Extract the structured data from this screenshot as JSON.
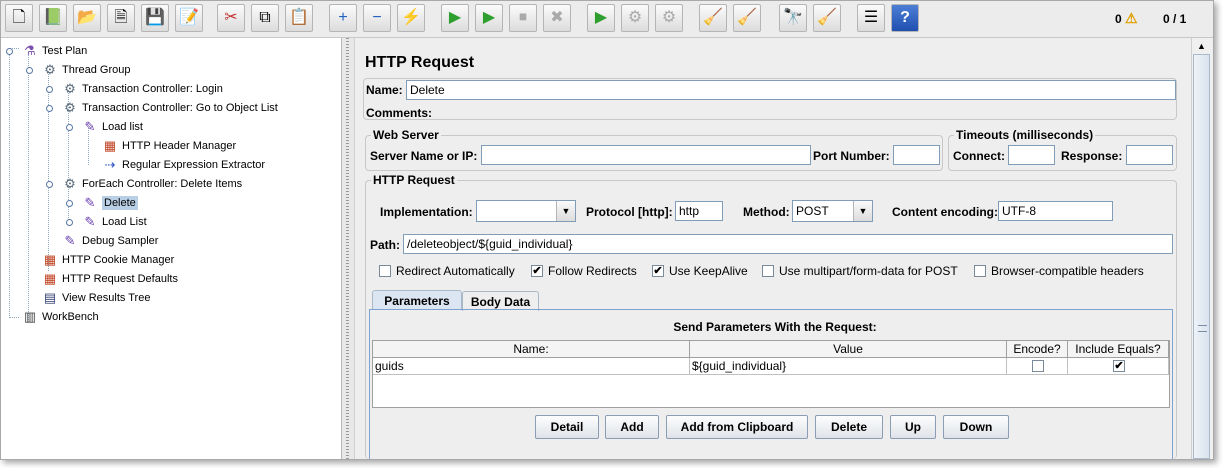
{
  "toolbar": {
    "buttons": [
      {
        "name": "new-icon",
        "glyph": "🗋"
      },
      {
        "name": "templates-icon",
        "glyph": "📗"
      },
      {
        "name": "open-icon",
        "glyph": "📂"
      },
      {
        "name": "close-icon",
        "glyph": "🗎"
      },
      {
        "name": "save-icon",
        "glyph": "💾"
      },
      {
        "name": "save-as-icon",
        "glyph": "📝"
      },
      {
        "name": "cut-icon",
        "glyph": "✂"
      },
      {
        "name": "copy-icon",
        "glyph": "⧉"
      },
      {
        "name": "paste-icon",
        "glyph": "📋"
      },
      {
        "name": "expand-icon",
        "glyph": "+"
      },
      {
        "name": "collapse-icon",
        "glyph": "−"
      },
      {
        "name": "toggle-icon",
        "glyph": "⚡"
      },
      {
        "name": "start-icon",
        "glyph": "▶"
      },
      {
        "name": "start-no-pauses-icon",
        "glyph": "▶"
      },
      {
        "name": "stop-icon",
        "glyph": "⏹"
      },
      {
        "name": "shutdown-icon",
        "glyph": "✖"
      },
      {
        "name": "remote-start-icon",
        "glyph": "▶"
      },
      {
        "name": "remote-stop-icon",
        "glyph": "⚙"
      },
      {
        "name": "remote-shutdown-icon",
        "glyph": "⚙"
      },
      {
        "name": "clear-icon",
        "glyph": "🧹"
      },
      {
        "name": "clear-all-icon",
        "glyph": "🧹"
      },
      {
        "name": "search-icon",
        "glyph": "🔭"
      },
      {
        "name": "reset-search-icon",
        "glyph": "🧹"
      },
      {
        "name": "function-helper-icon",
        "glyph": "☰"
      },
      {
        "name": "help-icon",
        "glyph": "?"
      }
    ],
    "warnings_count": "0",
    "warning_icon": "⚠",
    "threads": "0 / 1"
  },
  "tree": {
    "nodes": [
      {
        "label": "Test Plan",
        "icon": "⚗"
      },
      {
        "label": "Thread Group",
        "icon": "⚙"
      },
      {
        "label": "Transaction Controller: Login",
        "icon": "⚙"
      },
      {
        "label": "Transaction Controller: Go to Object List",
        "icon": "⚙"
      },
      {
        "label": "Load list",
        "icon": "✎"
      },
      {
        "label": "HTTP Header Manager",
        "icon": "▦"
      },
      {
        "label": "Regular Expression Extractor",
        "icon": "⇢"
      },
      {
        "label": "ForEach Controller: Delete Items",
        "icon": "⚙"
      },
      {
        "label": "Delete",
        "icon": "✎"
      },
      {
        "label": "Load List",
        "icon": "✎"
      },
      {
        "label": "Debug Sampler",
        "icon": "✎"
      },
      {
        "label": "HTTP Cookie Manager",
        "icon": "▦"
      },
      {
        "label": "HTTP Request Defaults",
        "icon": "▦"
      },
      {
        "label": "View Results Tree",
        "icon": "▤"
      },
      {
        "label": "WorkBench",
        "icon": "▥"
      }
    ]
  },
  "panel": {
    "title": "HTTP Request",
    "name_label": "Name:",
    "name_value": "Delete",
    "comments_label": "Comments:",
    "web_server": {
      "legend": "Web Server",
      "server_label": "Server Name or IP:",
      "server_value": "",
      "port_label": "Port Number:",
      "port_value": ""
    },
    "timeouts": {
      "legend": "Timeouts (milliseconds)",
      "connect_label": "Connect:",
      "connect_value": "",
      "response_label": "Response:",
      "response_value": ""
    },
    "http_request": {
      "legend": "HTTP Request",
      "implementation_label": "Implementation:",
      "implementation_value": "",
      "protocol_label": "Protocol [http]:",
      "protocol_value": "http",
      "method_label": "Method:",
      "method_value": "POST",
      "encoding_label": "Content encoding:",
      "encoding_value": "UTF-8",
      "path_label": "Path:",
      "path_value": "/deleteobject/${guid_individual}",
      "checkboxes": [
        {
          "label": "Redirect Automatically",
          "checked": false
        },
        {
          "label": "Follow Redirects",
          "checked": true
        },
        {
          "label": "Use KeepAlive",
          "checked": true
        },
        {
          "label": "Use multipart/form-data for POST",
          "checked": false
        },
        {
          "label": "Browser-compatible headers",
          "checked": false
        }
      ]
    },
    "tabs": [
      {
        "label": "Parameters",
        "active": true
      },
      {
        "label": "Body Data",
        "active": false
      }
    ],
    "params": {
      "heading": "Send Parameters With the Request:",
      "columns": [
        "Name:",
        "Value",
        "Encode?",
        "Include Equals?"
      ],
      "rows": [
        {
          "name": "guids",
          "value": "${guid_individual}",
          "encode": false,
          "include_equals": true
        }
      ]
    },
    "buttons": [
      "Detail",
      "Add",
      "Add from Clipboard",
      "Delete",
      "Up",
      "Down"
    ]
  },
  "colors": {
    "selection": "#b8cfe5",
    "border_blue": "#7f9db9",
    "background": "#eeeeee"
  }
}
